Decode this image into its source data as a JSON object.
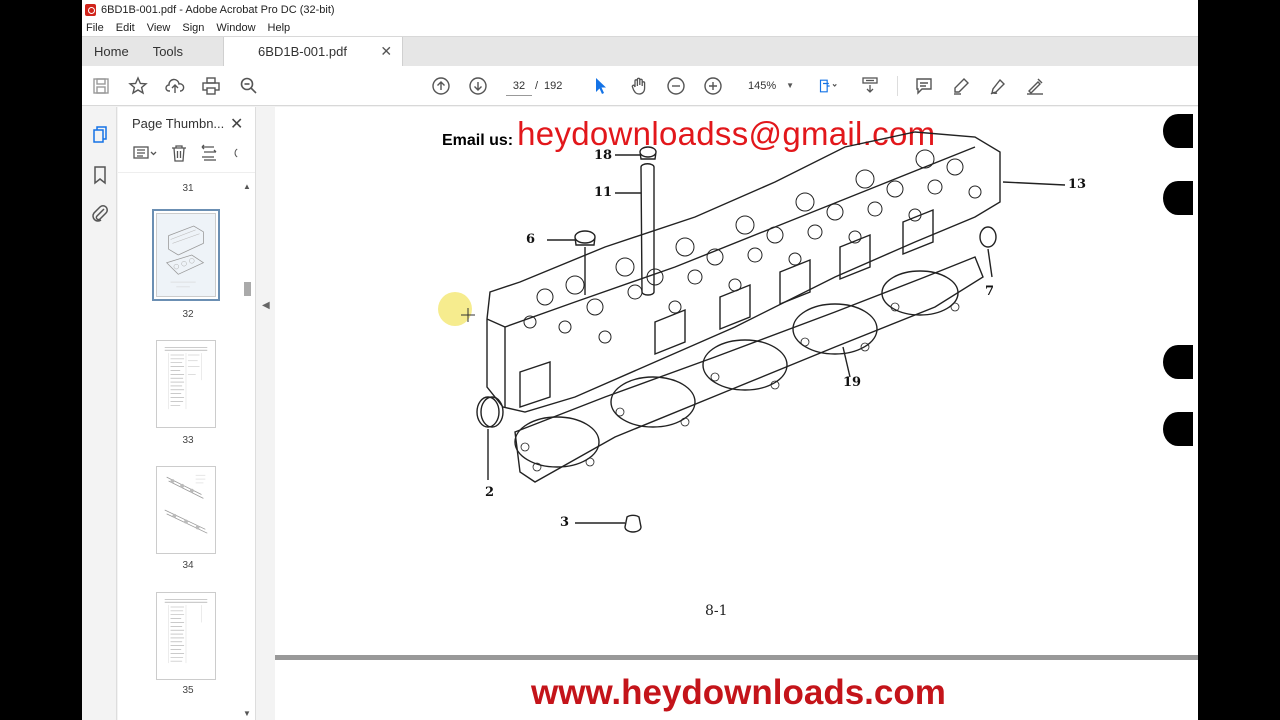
{
  "window": {
    "title": "6BD1B-001.pdf - Adobe Acrobat Pro DC (32-bit)"
  },
  "menu": [
    "File",
    "Edit",
    "View",
    "Sign",
    "Window",
    "Help"
  ],
  "tabs": {
    "home": "Home",
    "tools": "Tools",
    "document": "6BD1B-001.pdf"
  },
  "toolbar": {
    "current_page": "32",
    "page_separator": "/",
    "total_pages": "192",
    "zoom": "145%"
  },
  "thumbnails": {
    "title": "Page Thumbn...",
    "items": [
      {
        "page": "31"
      },
      {
        "page": "32",
        "selected": true
      },
      {
        "page": "33"
      },
      {
        "page": "34"
      },
      {
        "page": "35"
      }
    ]
  },
  "document": {
    "email_label": "Email us:",
    "email": "heydownloadss@gmail.com",
    "page_label": "8-1",
    "website": "www.heydownloads.com",
    "callouts": [
      "18",
      "11",
      "6",
      "13",
      "7",
      "19",
      "2",
      "3"
    ]
  },
  "colors": {
    "watermark_red": "#e2171b",
    "acrobat_red": "#d0241b",
    "selection": "#6b8fb3"
  }
}
